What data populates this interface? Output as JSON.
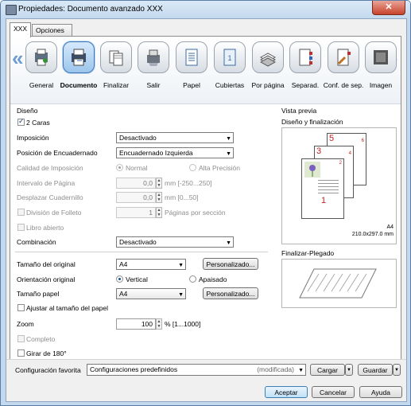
{
  "window": {
    "title": "Propiedades: Documento avanzado XXX",
    "close_glyph": "✕"
  },
  "tabs": [
    {
      "label": "XXX"
    },
    {
      "label": "Opciones avanzadas"
    }
  ],
  "nav": {
    "items": [
      {
        "label": "General",
        "icon": "general-icon"
      },
      {
        "label": "Documento",
        "icon": "document-icon"
      },
      {
        "label": "Finalizar",
        "icon": "finish-icon"
      },
      {
        "label": "Salir",
        "icon": "output-icon"
      },
      {
        "label": "Papel",
        "icon": "paper-icon"
      },
      {
        "label": "Cubiertas",
        "icon": "covers-icon"
      },
      {
        "label": "Por página",
        "icon": "per-page-icon"
      },
      {
        "label": "Separad.",
        "icon": "separators-icon"
      },
      {
        "label": "Conf. de sep.",
        "icon": "separator-settings-icon"
      },
      {
        "label": "Imagen",
        "icon": "image-icon"
      }
    ],
    "left_arrow": "«",
    "right_arrow": "»"
  },
  "design": {
    "group_title": "Diseño",
    "two_sided": {
      "label": "2 Caras",
      "checked": true
    },
    "imposition": {
      "label": "Imposición",
      "value": "Desactivado"
    },
    "binding_position": {
      "label": "Posición de Encuadernado",
      "value": "Encuadernado Izquierda"
    },
    "imposition_quality": {
      "label": "Calidad de Imposición",
      "opt1": "Normal",
      "opt2": "Alta Precisión"
    },
    "page_interval": {
      "label": "Intervalo de Página",
      "value": "0,0",
      "unit": "mm [-250...250]"
    },
    "booklet_shift": {
      "label": "Desplazar Cuadernillo",
      "value": "0,0",
      "unit": "mm [0...50]"
    },
    "booklet_division": {
      "label": "División de Folleto",
      "value": "1",
      "unit": "Páginas por sección"
    },
    "open_book": {
      "label": "Libro abierto"
    },
    "combination": {
      "label": "Combinación",
      "value": "Desactivado"
    }
  },
  "paper": {
    "original_size": {
      "label": "Tamaño del original",
      "value": "A4",
      "button": "Personalizado..."
    },
    "orientation": {
      "label": "Orientación original",
      "opt1": "Vertical",
      "opt2": "Apaisado"
    },
    "paper_size": {
      "label": "Tamaño papel",
      "value": "A4",
      "button": "Personalizado..."
    },
    "fit_to_paper": {
      "label": "Ajustar al tamaño del papel"
    },
    "zoom": {
      "label": "Zoom",
      "value": "100",
      "unit": "% [1...1000]"
    },
    "complete": {
      "label": "Completo"
    },
    "rotate": {
      "label": "Girar de 180°"
    }
  },
  "preview": {
    "title": "Vista previa",
    "section1": "Diseño y finalización",
    "page_numbers": [
      "5",
      "3",
      "1"
    ],
    "page_numbers_small": [
      "6",
      "4",
      "2"
    ],
    "paper_label": "A4",
    "paper_dims": "210.0x297.0 mm",
    "section2": "Finalizar-Plegado"
  },
  "favorites": {
    "label": "Configuración favorita",
    "value": "Configuraciones predefinidos",
    "status": "(modificada)",
    "load": "Cargar",
    "save": "Guardar"
  },
  "buttons": {
    "ok": "Aceptar",
    "cancel": "Cancelar",
    "help": "Ayuda"
  },
  "colors": {
    "accent": "#3f78b5",
    "page_number": "#c02020"
  }
}
